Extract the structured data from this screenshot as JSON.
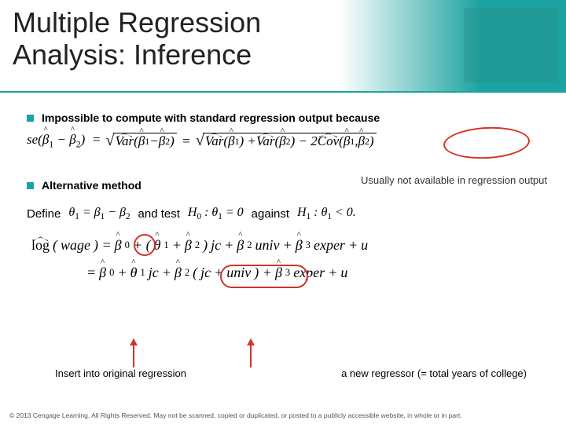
{
  "title_line1": "Multiple Regression",
  "title_line2": "Analysis: Inference",
  "bullet1": "Impossible to compute with standard regression output because",
  "se_formula": {
    "lhs": "se(β̂₁ − β̂₂)",
    "mid": "Var(β̂₁ − β̂₂)",
    "rhs_a": "Var(β̂₁)",
    "rhs_b": "Var(β̂₂)",
    "rhs_c": "Cov(β̂₁, β̂₂)"
  },
  "bullet2": "Alternative method",
  "annot_cov": "Usually not available in regression output",
  "define": {
    "word_define": "Define",
    "theta_def": "θ₁ = β₁ − β₂",
    "word_andtest": "and test",
    "h0": "H₀ : θ₁ = 0",
    "word_against": "against",
    "h1": "H₁ : θ₁ < 0."
  },
  "eqn1": "log(wage) = β₀ + (θ₁ + β₂) jc + β₂ univ + β₃ exper + u",
  "eqn2": "= β₀ + θ₁ jc + β₂ (jc + univ) + β₃ exper + u",
  "callout_left": "Insert into original regression",
  "callout_right": "a new regressor (= total years of college)",
  "footer": "© 2013 Cengage Learning. All Rights Reserved. May not be scanned, copied or duplicated, or posted to a publicly accessible website, in whole or in part."
}
